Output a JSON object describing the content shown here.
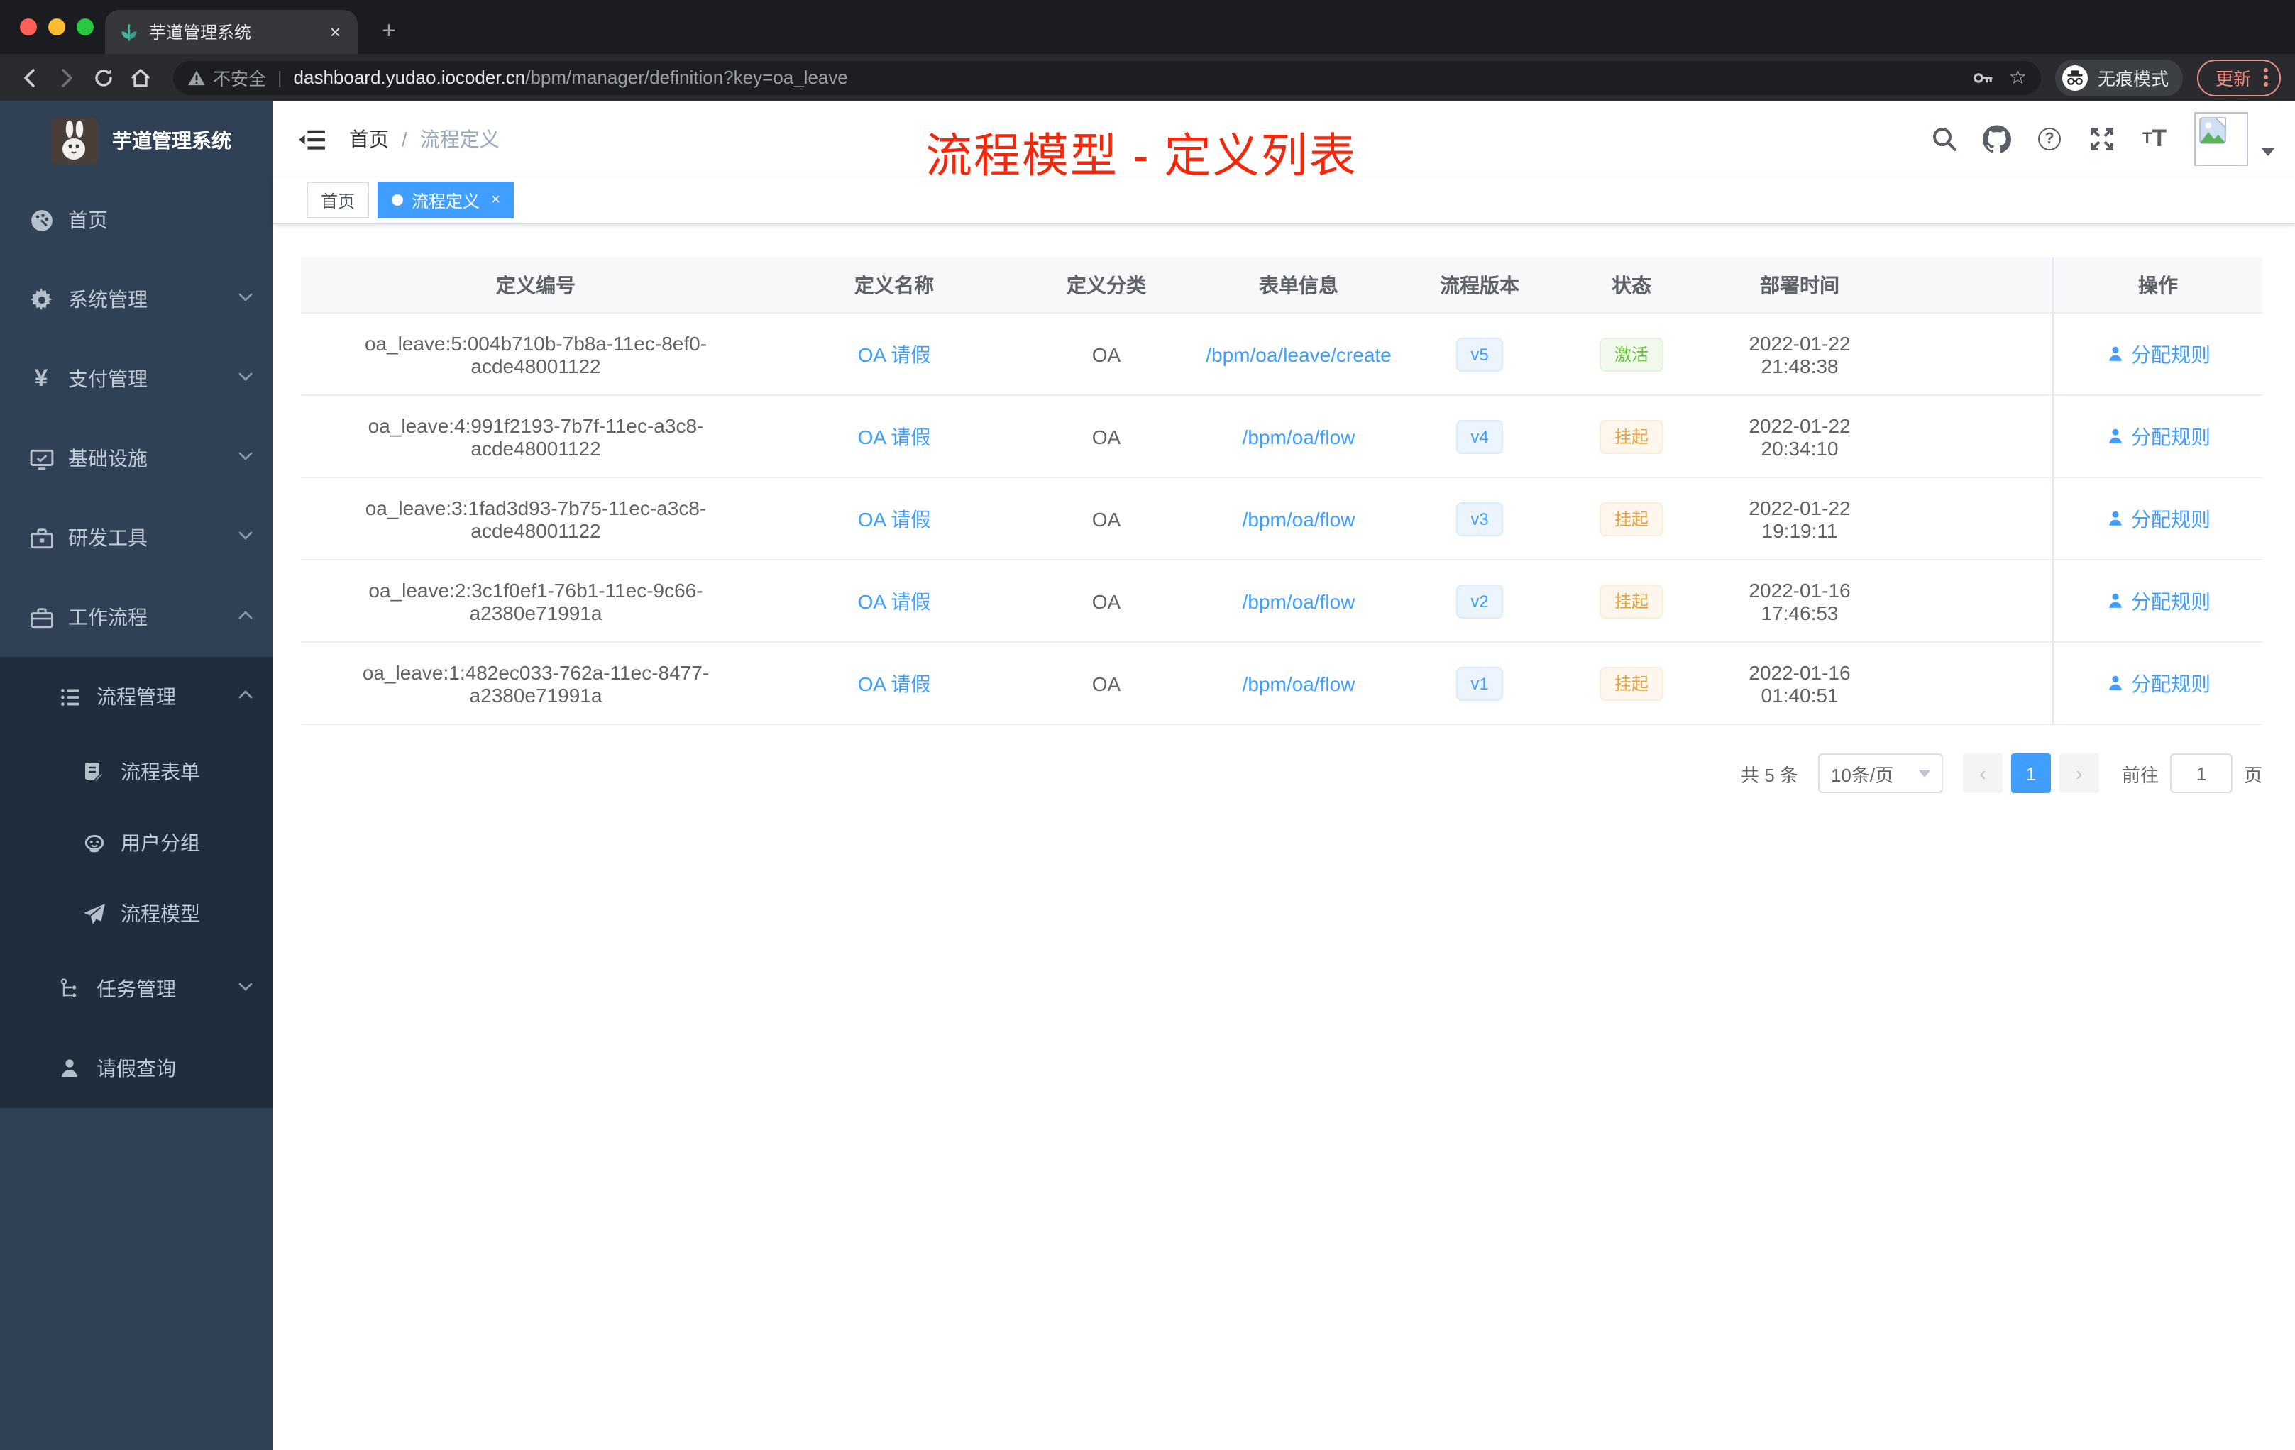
{
  "browser": {
    "tab_title": "芋道管理系统",
    "close_tab": "×",
    "security_label": "不安全",
    "url_host": "dashboard.yudao.iocoder.cn",
    "url_path": "/bpm/manager/definition?key=oa_leave",
    "incognito_label": "无痕模式",
    "update_label": "更新"
  },
  "sidebar": {
    "app_title": "芋道管理系统",
    "items": [
      {
        "label": "首页"
      },
      {
        "label": "系统管理"
      },
      {
        "label": "支付管理"
      },
      {
        "label": "基础设施"
      },
      {
        "label": "研发工具"
      },
      {
        "label": "工作流程"
      },
      {
        "label": "流程管理"
      },
      {
        "label": "流程表单"
      },
      {
        "label": "用户分组"
      },
      {
        "label": "流程模型"
      },
      {
        "label": "任务管理"
      },
      {
        "label": "请假查询"
      }
    ]
  },
  "header": {
    "breadcrumb_home": "首页",
    "breadcrumb_sep": "/",
    "breadcrumb_current": "流程定义",
    "annotation": "流程模型 - 定义列表"
  },
  "tags": {
    "home": "首页",
    "active": "流程定义",
    "close": "×"
  },
  "table": {
    "columns": [
      "定义编号",
      "定义名称",
      "定义分类",
      "表单信息",
      "流程版本",
      "状态",
      "部署时间",
      "操作"
    ],
    "rows": [
      {
        "id": "oa_leave:5:004b710b-7b8a-11ec-8ef0-acde48001122",
        "name": "OA 请假",
        "category": "OA",
        "form": "/bpm/oa/leave/create",
        "version": "v5",
        "status": "激活",
        "status_type": "success",
        "time": "2022-01-22 21:48:38",
        "action": "分配规则"
      },
      {
        "id": "oa_leave:4:991f2193-7b7f-11ec-a3c8-acde48001122",
        "name": "OA 请假",
        "category": "OA",
        "form": "/bpm/oa/flow",
        "version": "v4",
        "status": "挂起",
        "status_type": "warning",
        "time": "2022-01-22 20:34:10",
        "action": "分配规则"
      },
      {
        "id": "oa_leave:3:1fad3d93-7b75-11ec-a3c8-acde48001122",
        "name": "OA 请假",
        "category": "OA",
        "form": "/bpm/oa/flow",
        "version": "v3",
        "status": "挂起",
        "status_type": "warning",
        "time": "2022-01-22 19:19:11",
        "action": "分配规则"
      },
      {
        "id": "oa_leave:2:3c1f0ef1-76b1-11ec-9c66-a2380e71991a",
        "name": "OA 请假",
        "category": "OA",
        "form": "/bpm/oa/flow",
        "version": "v2",
        "status": "挂起",
        "status_type": "warning",
        "time": "2022-01-16 17:46:53",
        "action": "分配规则"
      },
      {
        "id": "oa_leave:1:482ec033-762a-11ec-8477-a2380e71991a",
        "name": "OA 请假",
        "category": "OA",
        "form": "/bpm/oa/flow",
        "version": "v1",
        "status": "挂起",
        "status_type": "warning",
        "time": "2022-01-16 01:40:51",
        "action": "分配规则"
      }
    ]
  },
  "pagination": {
    "total": "共 5 条",
    "page_size": "10条/页",
    "prev": "‹",
    "page": "1",
    "next": "›",
    "goto_label": "前往",
    "goto_value": "1",
    "unit": "页"
  },
  "colors": {
    "accent": "#409eff",
    "sidebar_bg": "#304156",
    "submenu_bg": "#1f2d3d",
    "success": "#67c23a",
    "warning": "#e6a23c",
    "annotation_red": "#f2270c"
  }
}
